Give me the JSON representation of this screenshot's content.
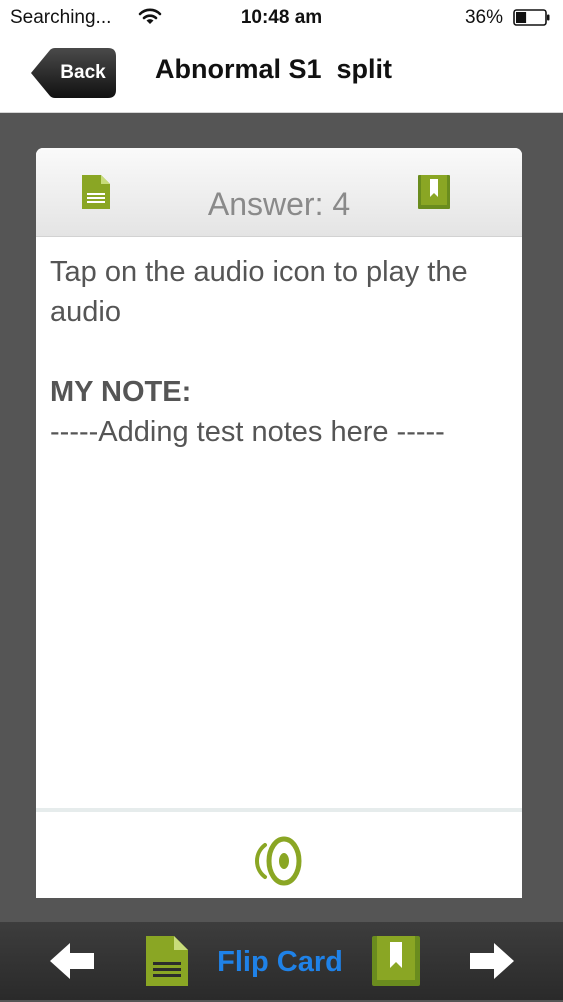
{
  "status_bar": {
    "carrier": "Searching...",
    "time": "10:48 am",
    "battery_percent": "36%",
    "battery_level": 0.36
  },
  "nav": {
    "back_label": "Back",
    "title": "Abnormal S1  split"
  },
  "card": {
    "answer_label": "Answer: 4",
    "instruction": "Tap on the audio icon to play the audio",
    "note_heading": "MY NOTE:",
    "note_text": "-----Adding test notes here -----"
  },
  "toolbar": {
    "flip_label": "Flip Card"
  },
  "colors": {
    "accent_green": "#8aa624",
    "link_blue": "#1f82e8",
    "background_gray": "#555555"
  },
  "icons": {
    "header_left": "notes-icon",
    "header_right": "bookmark-icon",
    "footer": "audio-icon",
    "toolbar": [
      "left-arrow-icon",
      "notes-icon",
      "bookmark-icon",
      "right-arrow-icon"
    ]
  }
}
